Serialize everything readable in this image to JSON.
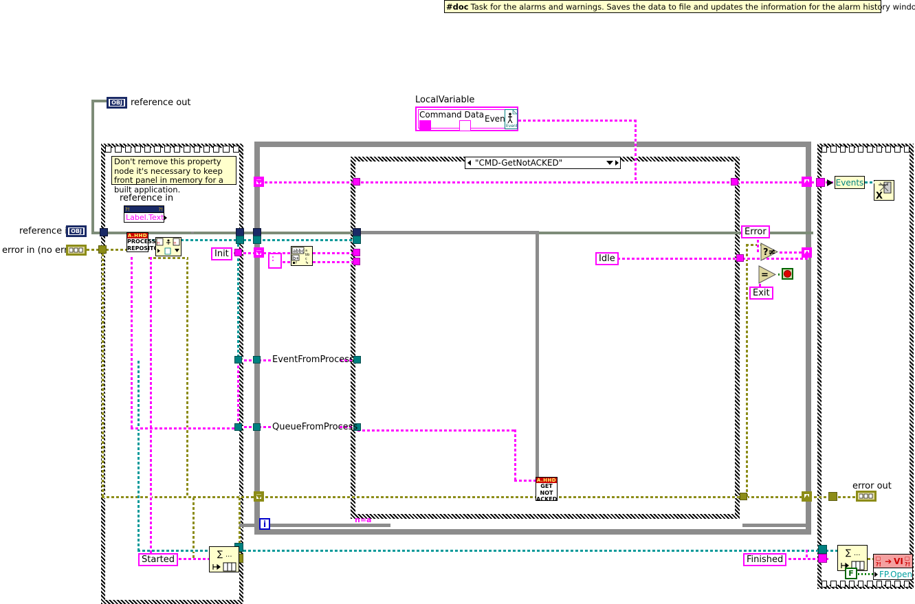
{
  "doc": {
    "tag": "#doc",
    "text": "Task for the alarms and warnings. Saves the data to file and updates the information for the alarm history window."
  },
  "terminals": {
    "reference_out_label": "reference out",
    "reference_out_value": "OBJ",
    "reference_in_label": "reference in",
    "reference_in_value": "OBJ",
    "error_in_label": "error in (no error)",
    "error_out_label": "error out"
  },
  "comment": {
    "text": "Don't remove this property node it's necessary to keep front panel in memory for a built application."
  },
  "property_node": {
    "label": "reference in",
    "property": "Label.Text"
  },
  "local_variable": {
    "title": "LocalVariable",
    "field_a": "Command Data",
    "field_b": "Events",
    "icon": "Event"
  },
  "case_structure": {
    "selector": "\"CMD-GetNotACKED\""
  },
  "string_constants": {
    "init": "Init",
    "idle": "Idle",
    "error": "Error",
    "exit": "Exit",
    "started": "Started",
    "finished": "Finished",
    "empty": ""
  },
  "tunnel_labels": {
    "event_from_process": "EventFromProcess",
    "queue_from_process": "QueueFromProcess",
    "events": "Events"
  },
  "subvis": {
    "process_repository": {
      "badge": "A.HHD",
      "line1": "PROCESS",
      "line2": "REPOSITOR"
    },
    "get_not_acked": {
      "badge": "A.HHD",
      "line1": "GET",
      "line2": "NOT",
      "line3": "ACKED"
    }
  },
  "fp_open": {
    "vi_label": "VI",
    "property": "FP.Open",
    "bool_constant": "F"
  },
  "loop": {
    "iteration_terminal": "i",
    "conditional_label": "n=a"
  },
  "colors": {
    "magenta_wire": "#ff00ff",
    "error_wire": "#8c8c18",
    "refnum_wire": "#7d8c78",
    "teal_wire": "#008080",
    "structure_grey": "#8c8c8c",
    "comment_bg": "#ffffcc",
    "subvi_header": "#cc0000"
  }
}
